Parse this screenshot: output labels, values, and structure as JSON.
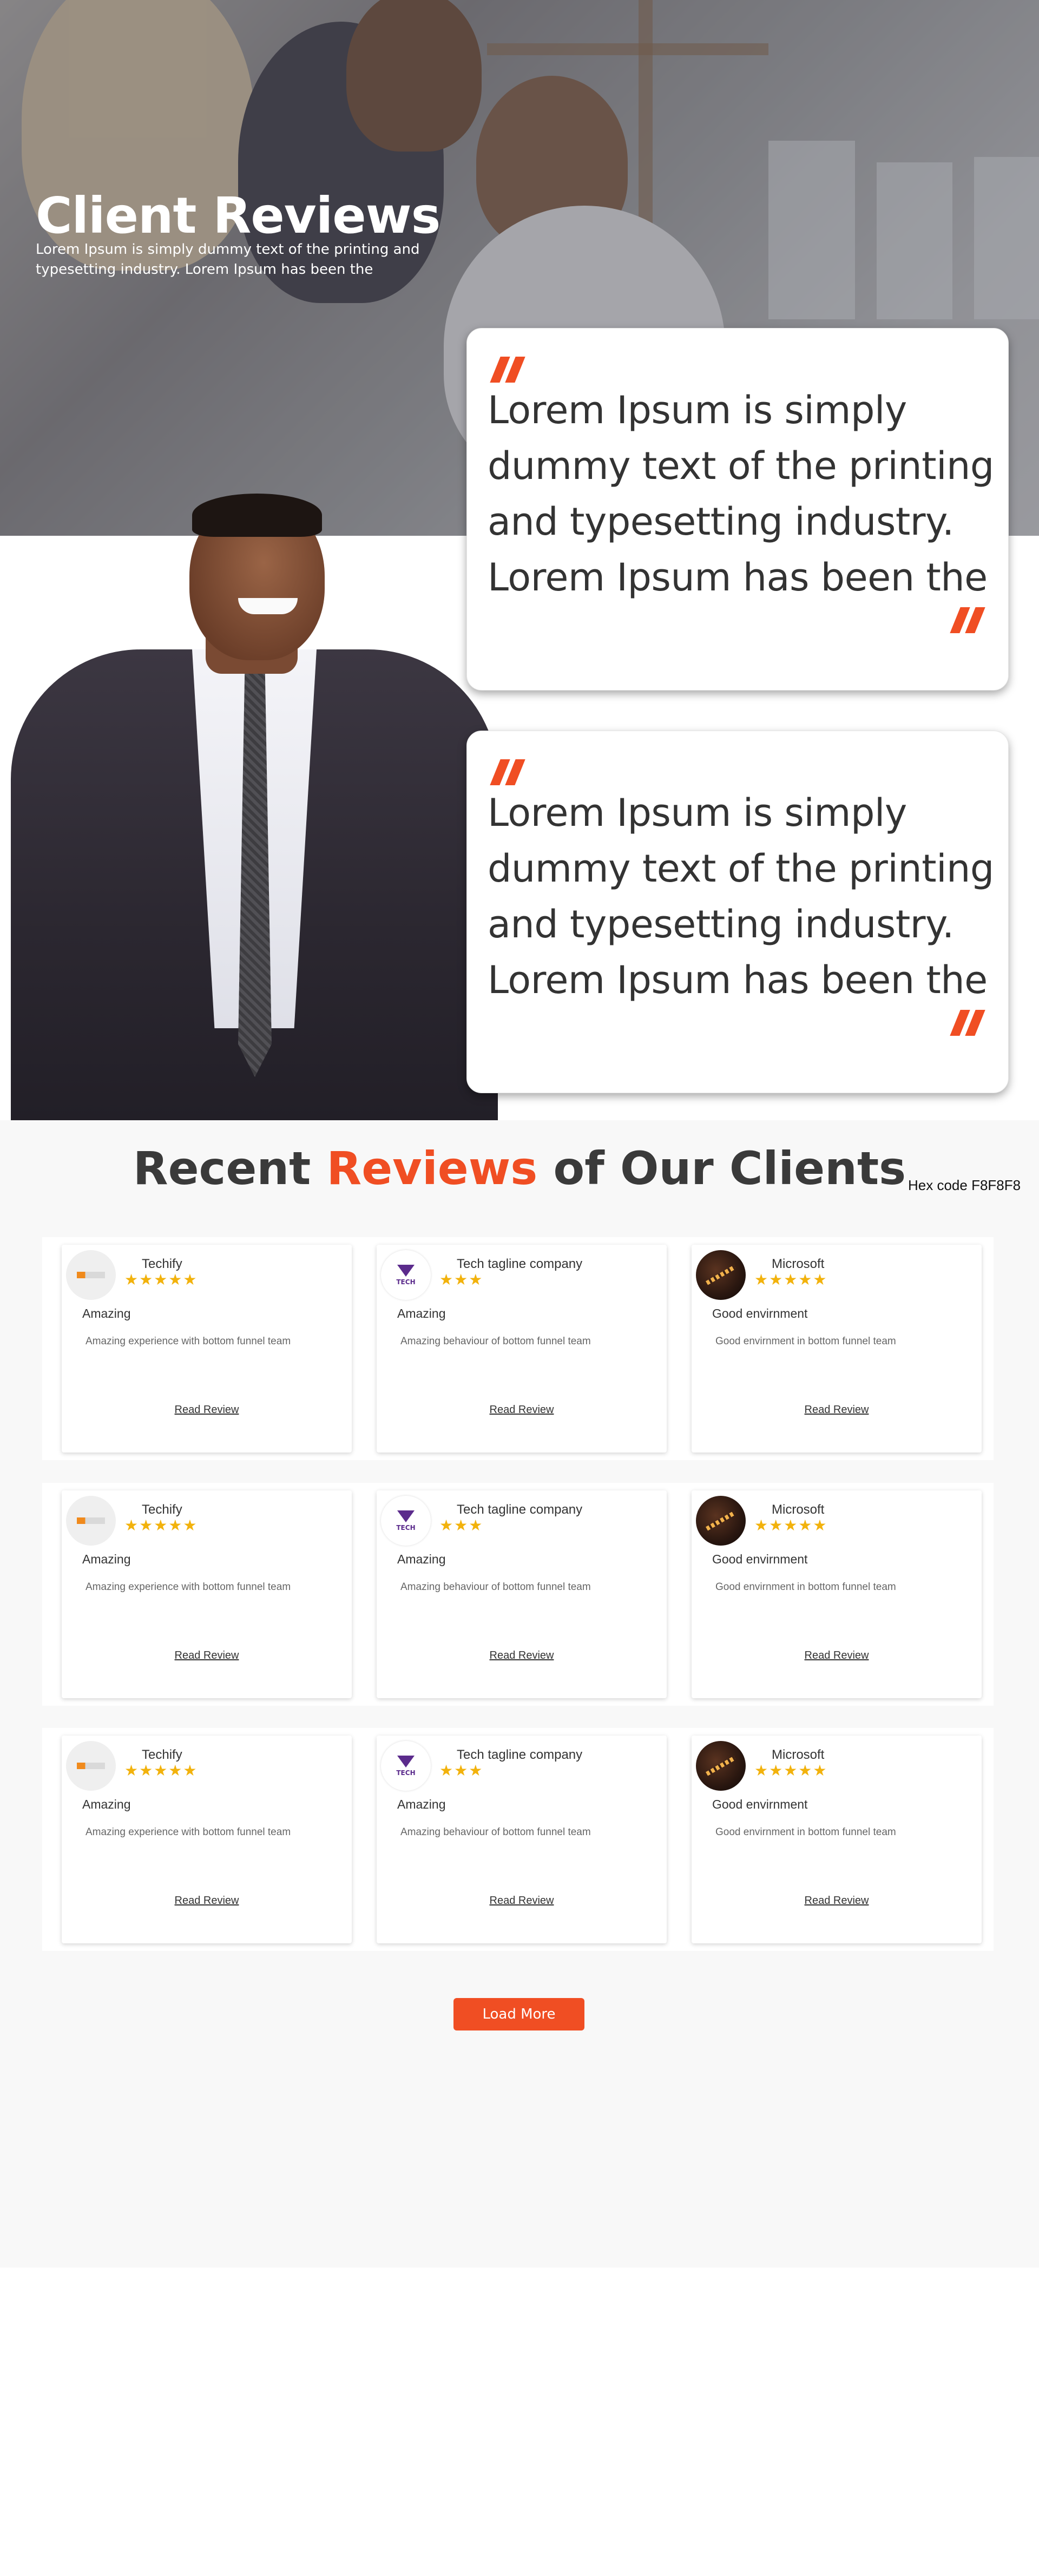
{
  "hero": {
    "title": "Client Reviews",
    "subtitle": "Lorem Ipsum is simply dummy text of the printing and typesetting industry. Lorem Ipsum has been the"
  },
  "quotes": [
    {
      "text": "Lorem Ipsum is simply dummy text of the printing and typesetting industry. Lorem Ipsum has been the"
    },
    {
      "text": "Lorem Ipsum is simply dummy text of the printing and typesetting industry. Lorem Ipsum has been the"
    }
  ],
  "section": {
    "title_pre": "Recent ",
    "title_accent": "Reviews",
    "title_post": " of Our Clients",
    "hex_note": "Hex code  F8F8F8",
    "background": "#f8f8f8",
    "accent": "#f04e23"
  },
  "rows": [
    {
      "cards": [
        {
          "company": "Techify",
          "stars": "★★★★★",
          "title": "Amazing",
          "text": "Amazing experience with bottom funnel team",
          "link": "Read Review",
          "logo": "techify-logo"
        },
        {
          "company": "Tech tagline company",
          "stars": "★★★",
          "title": "Amazing",
          "text": "Amazing behaviour of bottom funnel team",
          "link": "Read Review",
          "logo": "tech-logo",
          "logo_text": "TECH"
        },
        {
          "company": "Microsoft",
          "stars": "★★★★★",
          "title": "Good envirnment",
          "text": "Good envirnment in bottom funnel team",
          "link": "Read Review",
          "logo": "microsoft-photo"
        }
      ]
    },
    {
      "cards": [
        {
          "company": "Techify",
          "stars": "★★★★★",
          "title": "Amazing",
          "text": "Amazing experience with bottom funnel team",
          "link": "Read Review",
          "logo": "techify-logo"
        },
        {
          "company": "Tech tagline company",
          "stars": "★★★",
          "title": "Amazing",
          "text": "Amazing behaviour of bottom funnel team",
          "link": "Read Review",
          "logo": "tech-logo",
          "logo_text": "TECH"
        },
        {
          "company": "Microsoft",
          "stars": "★★★★★",
          "title": "Good envirnment",
          "text": "Good envirnment in bottom funnel team",
          "link": "Read Review",
          "logo": "microsoft-photo"
        }
      ]
    },
    {
      "cards": [
        {
          "company": "Techify",
          "stars": "★★★★★",
          "title": "Amazing",
          "text": "Amazing experience with bottom funnel team",
          "link": "Read Review",
          "logo": "techify-logo"
        },
        {
          "company": "Tech tagline company",
          "stars": "★★★",
          "title": "Amazing",
          "text": "Amazing behaviour of bottom funnel team",
          "link": "Read Review",
          "logo": "tech-logo",
          "logo_text": "TECH"
        },
        {
          "company": "Microsoft",
          "stars": "★★★★★",
          "title": "Good envirnment",
          "text": "Good envirnment in bottom funnel team",
          "link": "Read Review",
          "logo": "microsoft-photo"
        }
      ]
    }
  ],
  "load_more": "Load More",
  "star_color": "#f2b20c"
}
